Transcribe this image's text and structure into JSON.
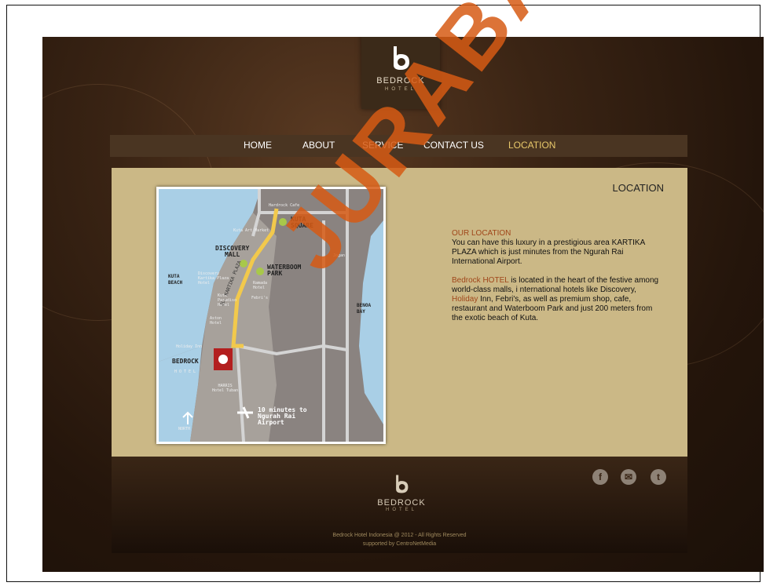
{
  "brand": {
    "name": "BEDROCK",
    "sub": "HOTEL"
  },
  "nav": {
    "items": [
      {
        "label": "HOME"
      },
      {
        "label": "ABOUT"
      },
      {
        "label": "SERVICE"
      },
      {
        "label": "CONTACT US"
      },
      {
        "label": "LOCATION",
        "active": true
      }
    ]
  },
  "page": {
    "title": "LOCATION"
  },
  "map": {
    "labels": {
      "hardrock": "Hardrock Cafe",
      "kuta_square": "KUTA\nSQUARE",
      "art_market": "Kuta Art Market",
      "discovery": "DISCOVERY\nMALL",
      "waterboom": "WATERBOOM\nPARK",
      "kuta_beach": "KUTA\nBEACH",
      "discovery_plaza": "Discovery\nKartika Plaza\nHotel",
      "ramada": "Ramada\nHotel",
      "paradiso": "Kuta\nParadiso\nHotel",
      "febris": "Febri's",
      "aston": "Aston\nHotel",
      "holiday": "Holiday Inn",
      "bedrock": "BEDROCK",
      "bedrock_sub": "HOTEL",
      "harris": "HARRIS\nHotel Tuban",
      "jogan": "Jogan",
      "benoa": "BENOA\nBAY",
      "street": "JL. KARTIKA PLAZA",
      "airport": "10 minutes to\nNgurah Rai\nAirport",
      "north": "NORTH"
    }
  },
  "info": {
    "heading": "OUR LOCATION",
    "para1": "You can have this luxury in a prestigious area KARTIKA PLAZA which is just minutes from the Ngurah Rai International Airport.",
    "p2_hl1": "Bedrock HOTEL",
    "p2_t1": " is located in the heart of the festive among world-class malls, i nternational hotels like Discovery, ",
    "p2_hl2": "Holiday",
    "p2_t2": " Inn, Febri's, as well as premium shop, cafe, restaurant and Waterboom Park and just 200 meters from the exotic beach of Kuta."
  },
  "footer": {
    "social": [
      "facebook-icon",
      "email-icon",
      "twitter-icon"
    ],
    "copyright": "Bedrock Hotel Indonesia @ 2012 - All Rights Reserved",
    "supported": "supported by CentroNetMedia"
  },
  "watermark": "JURABAYA"
}
